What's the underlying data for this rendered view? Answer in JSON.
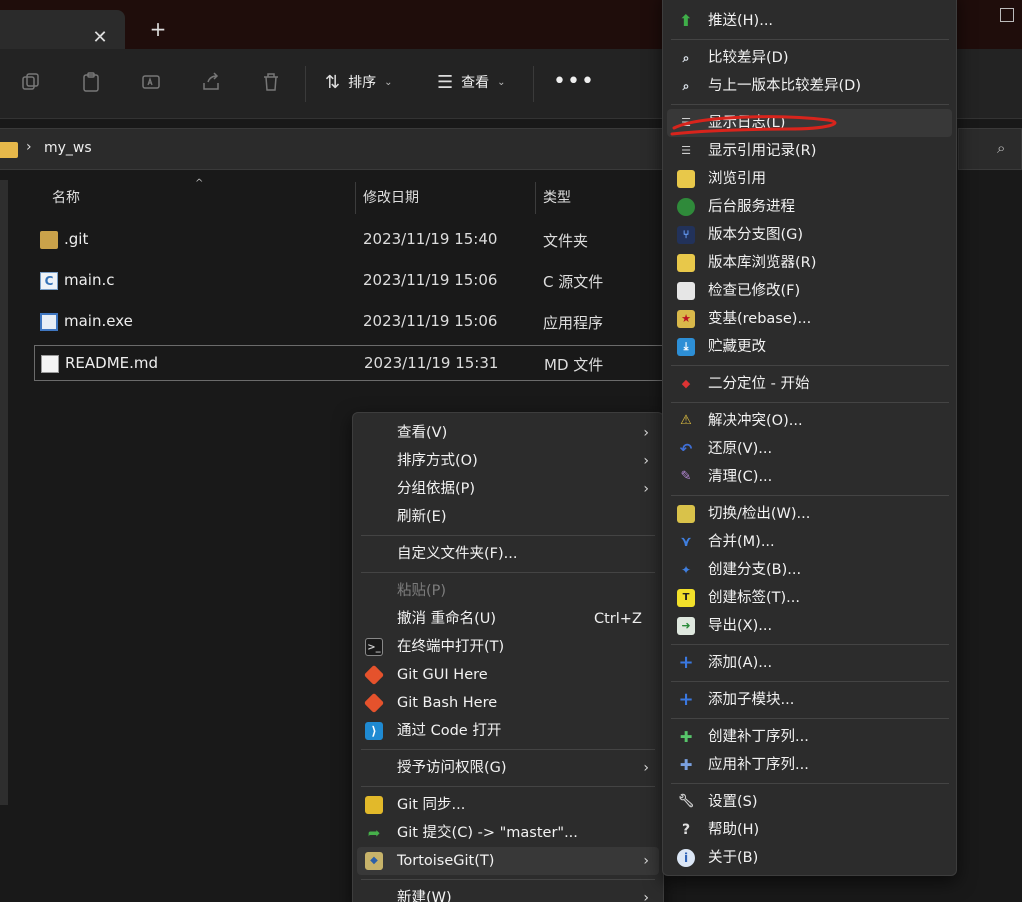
{
  "titlebar": {
    "close_glyph": "✕",
    "new_tab_glyph": "+"
  },
  "toolbar": {
    "sort_label": "排序",
    "view_label": "查看",
    "more_glyph": "•••",
    "icons": [
      "copy-icon",
      "paste-icon",
      "rename-icon",
      "share-icon",
      "delete-icon"
    ]
  },
  "address": {
    "breadcrumb": "my_ws",
    "separator": "›"
  },
  "columns": {
    "name": "名称",
    "date": "修改日期",
    "type": "类型"
  },
  "files": [
    {
      "name": ".git",
      "date": "2023/11/19 15:40",
      "type": "文件夹",
      "icon": "folder-icon"
    },
    {
      "name": "main.c",
      "date": "2023/11/19 15:06",
      "type": "C 源文件",
      "icon": "c-file-icon"
    },
    {
      "name": "main.exe",
      "date": "2023/11/19 15:06",
      "type": "应用程序",
      "icon": "exe-icon"
    },
    {
      "name": "README.md",
      "date": "2023/11/19 15:31",
      "type": "MD 文件",
      "icon": "markdown-file-icon"
    }
  ],
  "context_menu": {
    "view": "查看(V)",
    "sort_by": "排序方式(O)",
    "group_by": "分组依据(P)",
    "refresh": "刷新(E)",
    "customize": "自定义文件夹(F)...",
    "paste": "粘贴(P)",
    "undo": "撤消 重命名(U)",
    "undo_shortcut": "Ctrl+Z",
    "open_terminal": "在终端中打开(T)",
    "git_gui": "Git GUI Here",
    "git_bash": "Git Bash Here",
    "open_code": "通过 Code 打开",
    "grant_access": "授予访问权限(G)",
    "git_sync": "Git 同步...",
    "git_commit": "Git 提交(C) -> \"master\"...",
    "tortoisegit": "TortoiseGit(T)",
    "new": "新建(W)",
    "submenu_arrow": "›"
  },
  "submenu": {
    "push": "推送(H)...",
    "diff": "比较差异(D)",
    "diff_prev": "与上一版本比较差异(D)",
    "show_log": "显示日志(L)",
    "show_reflog": "显示引用记录(R)",
    "browse_refs": "浏览引用",
    "daemon": "后台服务进程",
    "revision_graph": "版本分支图(G)",
    "repo_browser": "版本库浏览器(R)",
    "check_mods": "检查已修改(F)",
    "rebase": "变基(rebase)...",
    "stash": "贮藏更改",
    "bisect": "二分定位 - 开始",
    "resolve": "解决冲突(O)...",
    "revert": "还原(V)...",
    "clean": "清理(C)...",
    "switch": "切换/检出(W)...",
    "merge": "合并(M)...",
    "branch": "创建分支(B)...",
    "tag": "创建标签(T)...",
    "export": "导出(X)...",
    "add": "添加(A)...",
    "add_submodule": "添加子模块...",
    "create_patch": "创建补丁序列...",
    "apply_patch": "应用补丁序列...",
    "settings": "设置(S)",
    "help": "帮助(H)",
    "about": "关于(B)"
  },
  "colors": {
    "accent_red": "#d8241c",
    "menu_bg": "#2c2c2c",
    "window_bg": "#191919"
  }
}
